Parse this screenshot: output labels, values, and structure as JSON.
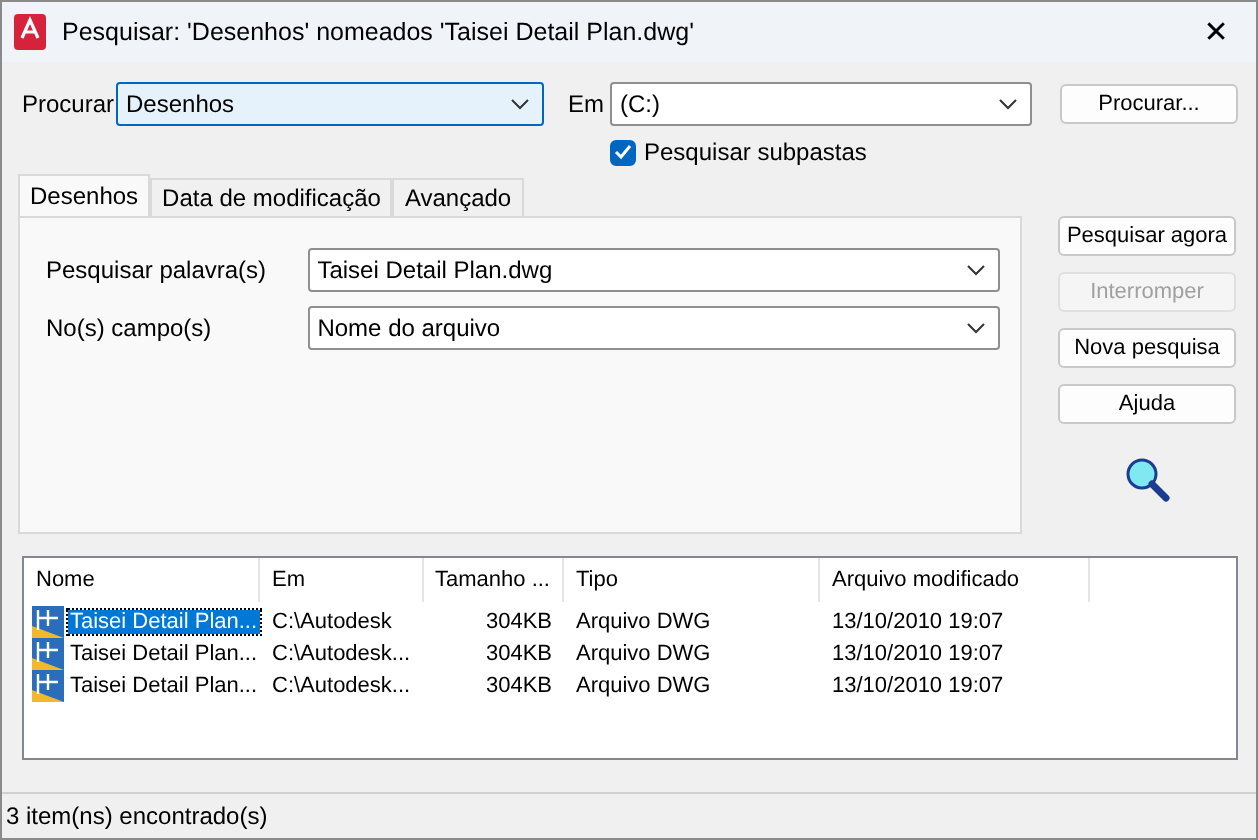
{
  "window": {
    "title": "Pesquisar: 'Desenhos' nomeados 'Taisei Detail Plan.dwg'",
    "close": "✕"
  },
  "search_bar": {
    "look_label": "Procurar",
    "look_value": "Desenhos",
    "in_label": "Em",
    "in_value": "(C:)",
    "browse_button": "Procurar...",
    "subfolders": {
      "label": "Pesquisar subpastas",
      "checked": true
    }
  },
  "tabs": [
    {
      "label": "Desenhos",
      "selected": true
    },
    {
      "label": "Data de modificação",
      "selected": false
    },
    {
      "label": "Avançado",
      "selected": false
    }
  ],
  "fields": [
    {
      "label": "Pesquisar palavra(s)",
      "value": "Taisei Detail Plan.dwg"
    },
    {
      "label": "No(s) campo(s)",
      "value": "Nome do arquivo"
    }
  ],
  "buttons": [
    {
      "label": "Pesquisar agora",
      "disabled": false
    },
    {
      "label": "Interromper",
      "disabled": true
    },
    {
      "label": "Nova pesquisa",
      "disabled": false
    },
    {
      "label": "Ajuda",
      "disabled": false
    }
  ],
  "table": {
    "columns": [
      "Nome",
      "Em",
      "Tamanho ...",
      "Tipo",
      "Arquivo modificado"
    ],
    "rows": [
      {
        "cells": [
          "Taisei Detail Plan...",
          "C:\\Autodesk",
          "304KB",
          "Arquivo DWG",
          "13/10/2010 19:07"
        ],
        "selected": true
      },
      {
        "cells": [
          "Taisei Detail Plan...",
          "C:\\Autodesk...",
          "304KB",
          "Arquivo DWG",
          "13/10/2010 19:07"
        ],
        "selected": false
      },
      {
        "cells": [
          "Taisei Detail Plan...",
          "C:\\Autodesk...",
          "304KB",
          "Arquivo DWG",
          "13/10/2010 19:07"
        ],
        "selected": false
      }
    ]
  },
  "status_bar": "3 item(ns) encontrado(s)"
}
